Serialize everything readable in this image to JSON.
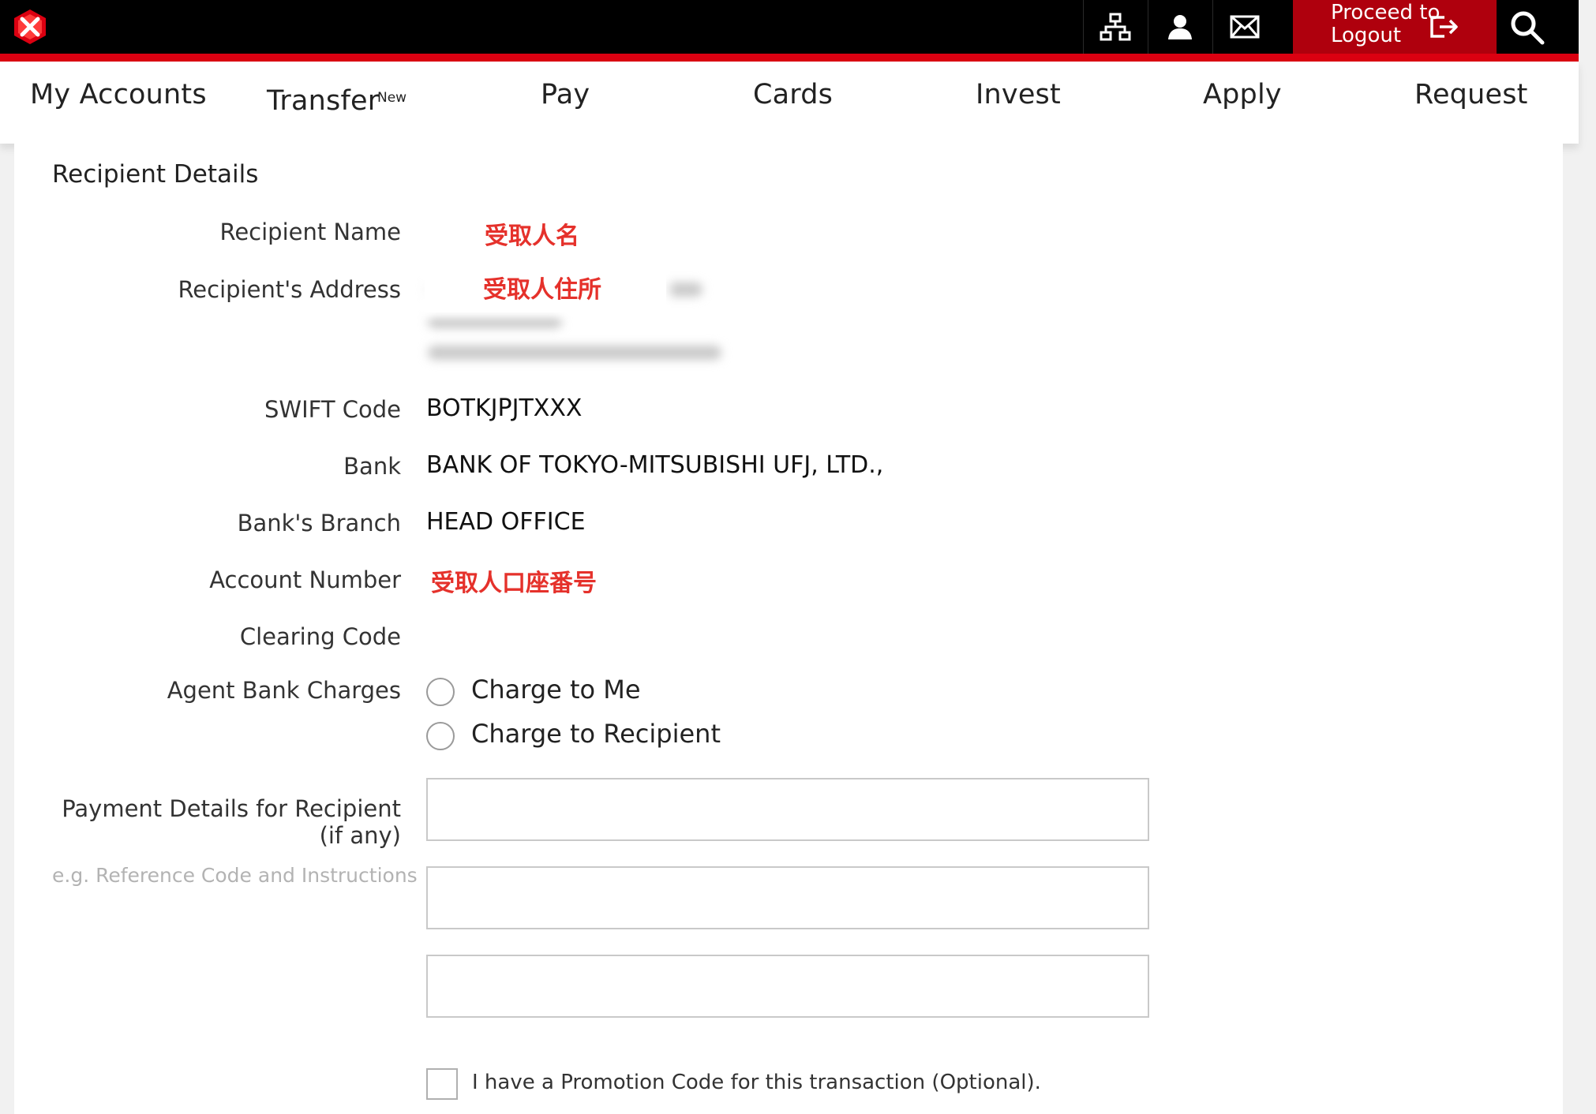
{
  "header": {
    "logo_icon": "hexagon-logo-icon",
    "icons": [
      "sitemap-icon",
      "user-icon",
      "mail-icon"
    ],
    "logout_line1": "Proceed to",
    "logout_line2": "Logout",
    "logout_icon": "logout-icon",
    "search_icon": "search-icon",
    "accent_color": "#db0011",
    "logout_bg_color": "#af000d"
  },
  "nav": {
    "items": [
      {
        "label": "My Accounts"
      },
      {
        "label": "Transfer",
        "badge": "New"
      },
      {
        "label": "Pay"
      },
      {
        "label": "Cards"
      },
      {
        "label": "Invest"
      },
      {
        "label": "Apply"
      },
      {
        "label": "Request"
      }
    ]
  },
  "form": {
    "section_title": "Recipient Details",
    "recipient_name_label": "Recipient Name",
    "recipient_name_value": "受取人名",
    "recipient_address_label": "Recipient's Address",
    "recipient_address_value": "受取人住所",
    "swift_label": "SWIFT Code",
    "swift_value": "BOTKJPJTXXX",
    "bank_label": "Bank",
    "bank_value": "BANK OF TOKYO-MITSUBISHI UFJ, LTD.,",
    "branch_label": "Bank's Branch",
    "branch_value": "HEAD OFFICE",
    "account_label": "Account Number",
    "account_value": "受取人口座番号",
    "clearing_label": "Clearing Code",
    "charges_label": "Agent Bank Charges",
    "charge_options": [
      "Charge to Me",
      "Charge to Recipient"
    ],
    "payment_details_label_1": "Payment Details for Recipient",
    "payment_details_label_2": "(if any)",
    "payment_details_hint": "e.g. Reference Code and Instructions",
    "promo_label": "I have a Promotion Code for this transaction (Optional)."
  }
}
